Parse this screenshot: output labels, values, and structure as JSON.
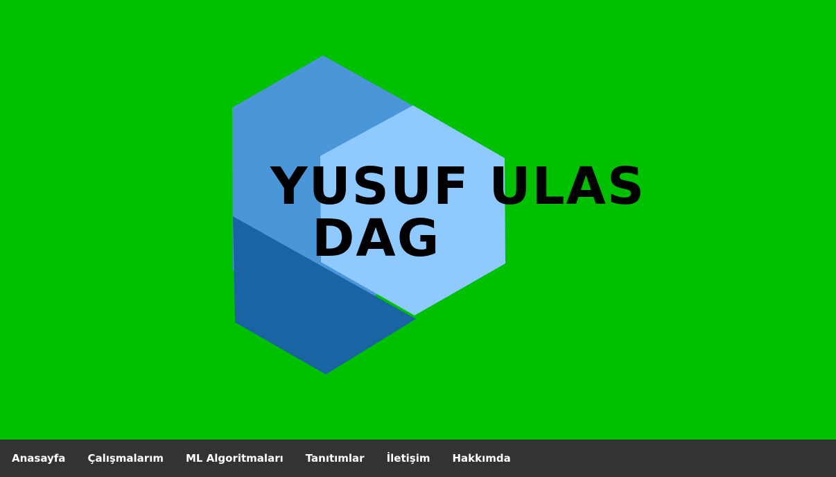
{
  "hero": {
    "background": "#00c000",
    "logo": {
      "title_line1": "YUSUF ULAS",
      "title_line2": "DAG",
      "colors": {
        "hex_top": "#4a96d9",
        "hex_bottom": "#1a64a4",
        "hex_front": "#8ec9ff",
        "text": "#000000"
      }
    }
  },
  "nav": {
    "background": "#333333",
    "items": [
      {
        "label": "Anasayfa"
      },
      {
        "label": "Çalışmalarım"
      },
      {
        "label": "ML Algoritmaları"
      },
      {
        "label": "Tanıtımlar"
      },
      {
        "label": "İletişim"
      },
      {
        "label": "Hakkımda"
      }
    ]
  }
}
